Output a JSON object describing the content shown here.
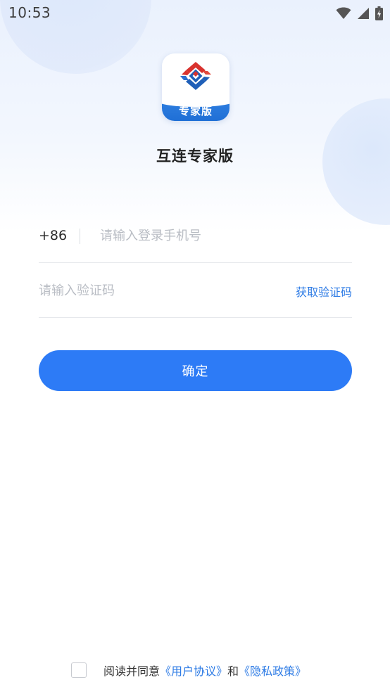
{
  "status_bar": {
    "time": "10:53",
    "icons": [
      "wifi-icon",
      "cellular-signal-icon",
      "battery-charging-icon"
    ]
  },
  "app": {
    "icon_badge": "专家版",
    "name": "互连专家版"
  },
  "login_form": {
    "country_code": "+86",
    "phone_placeholder": "请输入登录手机号",
    "code_placeholder": "请输入验证码",
    "get_code_label": "获取验证码",
    "confirm_label": "确定"
  },
  "agreement": {
    "prefix": "阅读并同意",
    "user_agreement": "《用户协议》",
    "conjunction": "和",
    "privacy_policy": "《隐私政策》",
    "checked": false
  },
  "colors": {
    "accent": "#2d7bf6",
    "link": "#2d7be5"
  }
}
